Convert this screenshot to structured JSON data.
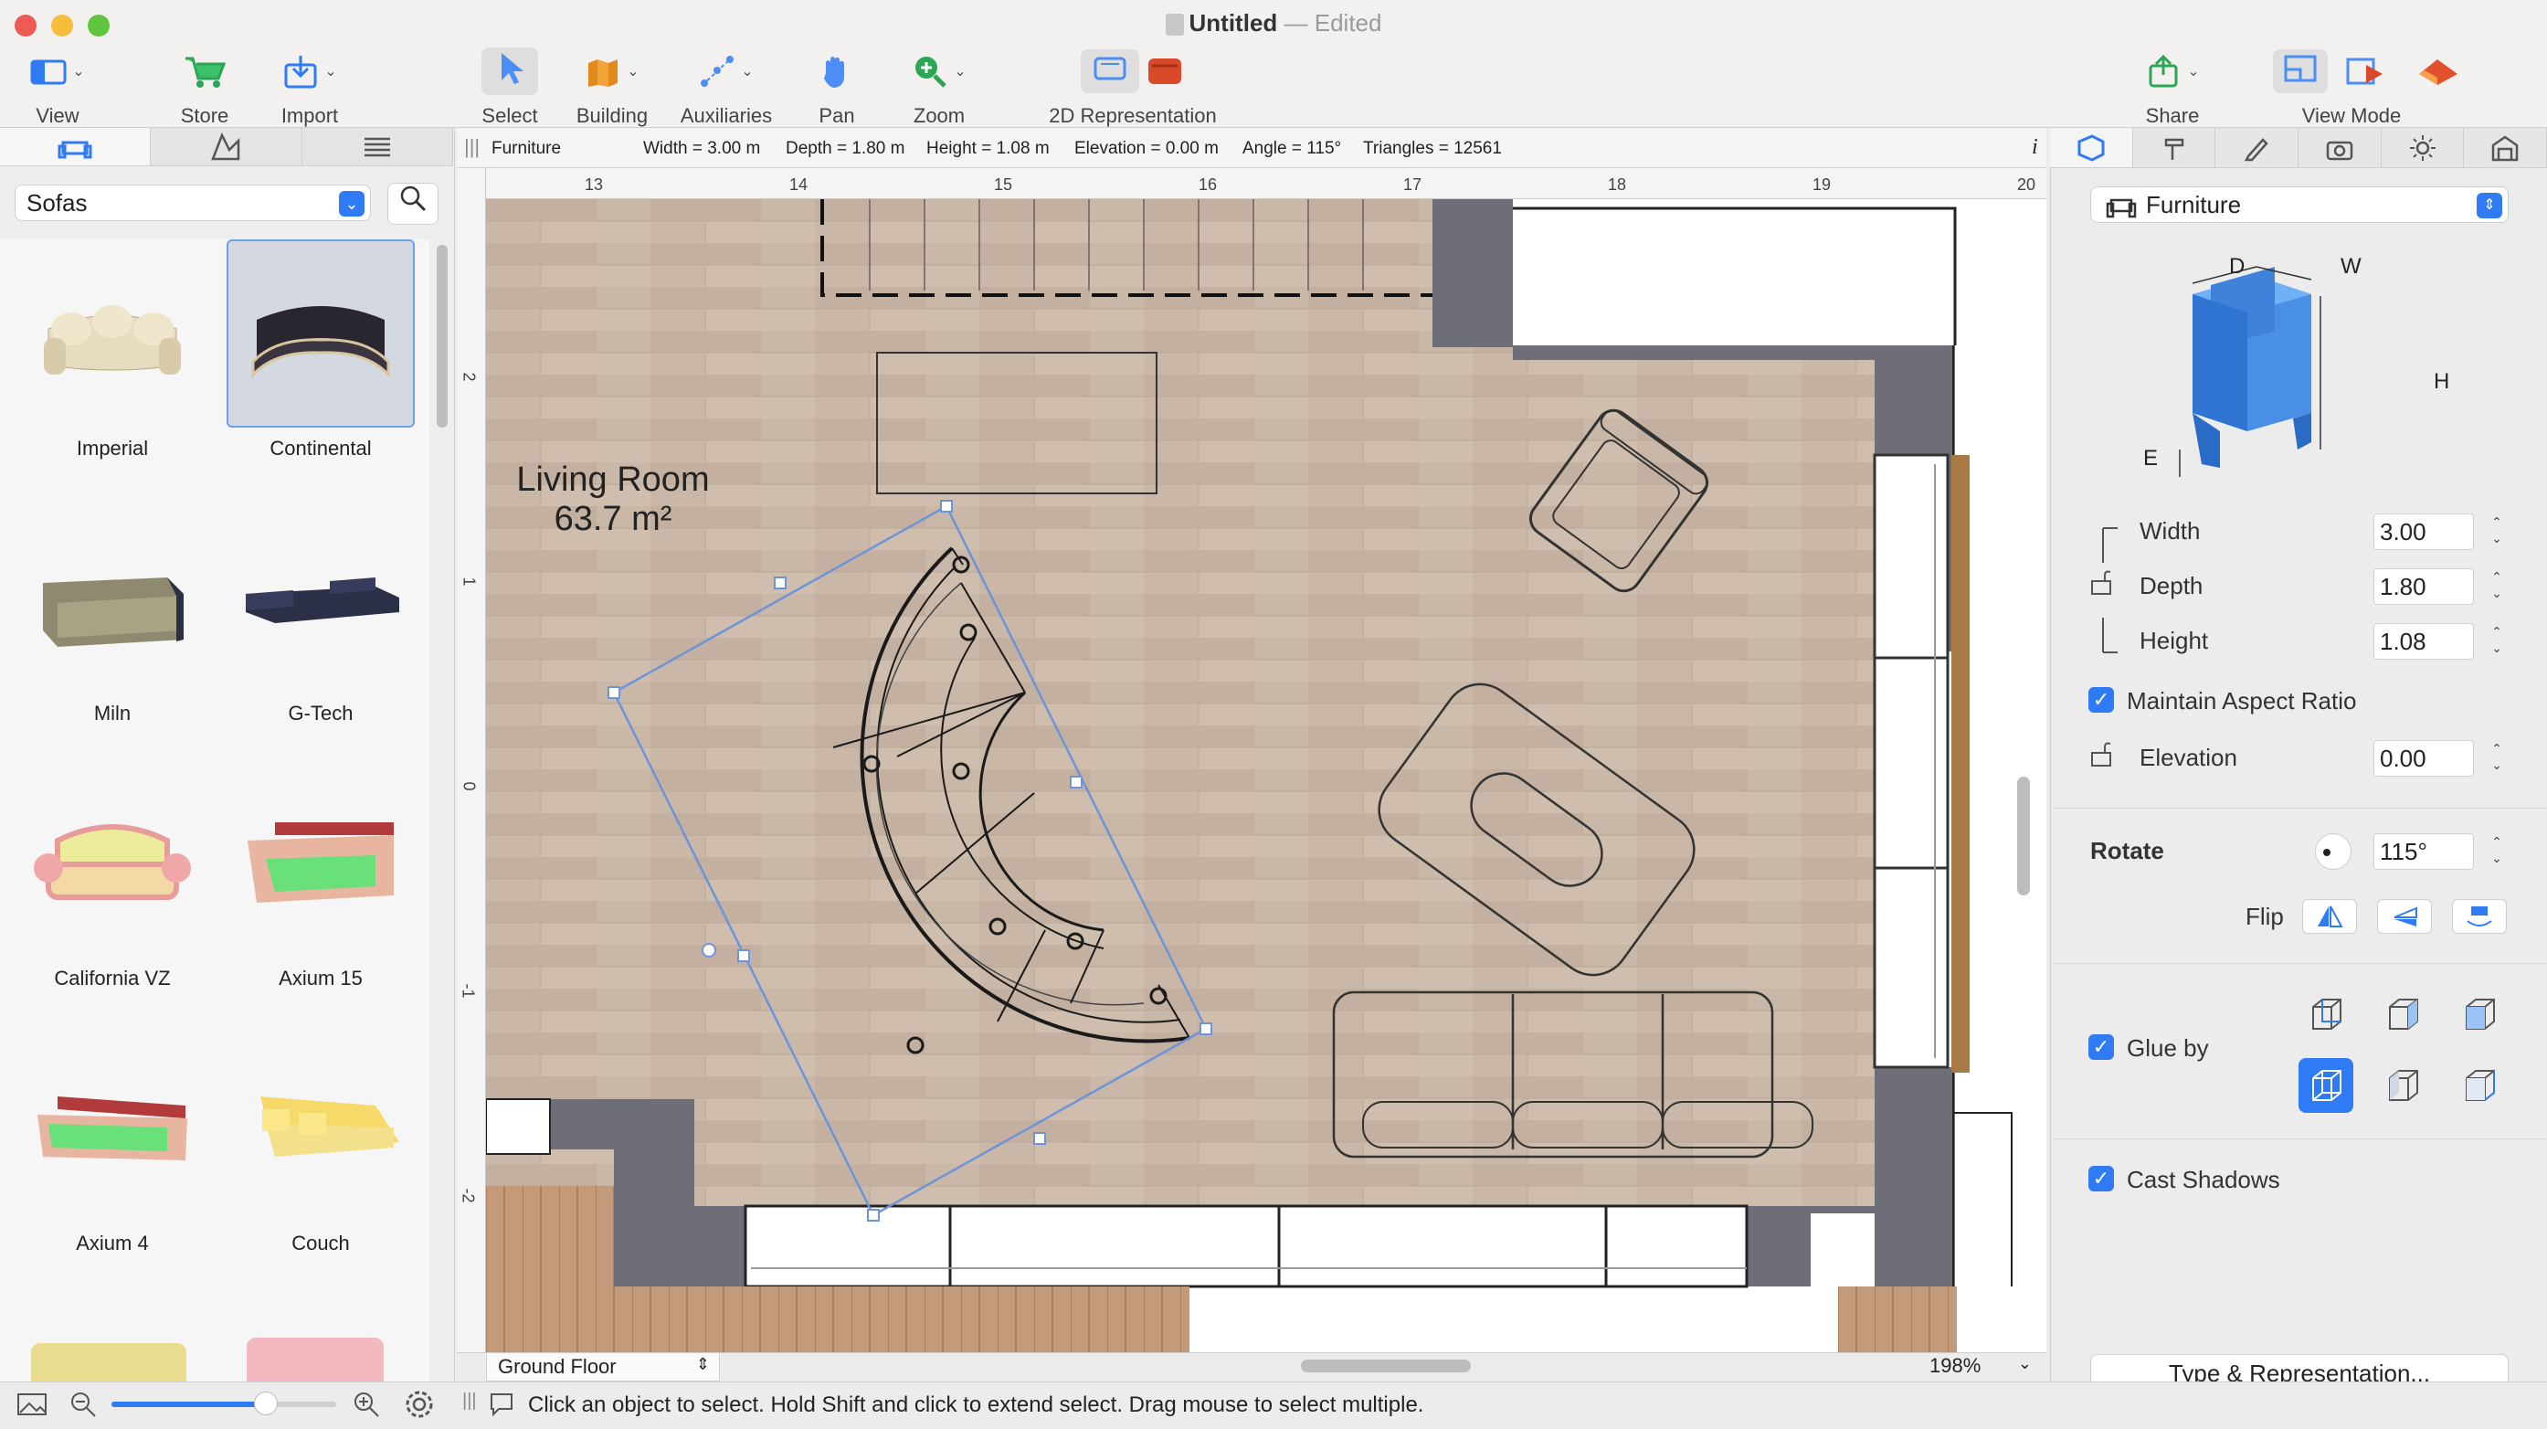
{
  "window": {
    "title": "Untitled",
    "edited": "— Edited"
  },
  "toolbar": {
    "view": "View",
    "store": "Store",
    "import": "Import",
    "select": "Select",
    "building": "Building",
    "auxiliaries": "Auxiliaries",
    "pan": "Pan",
    "zoom": "Zoom",
    "representation_2d": "2D Representation",
    "share": "Share",
    "view_mode": "View Mode"
  },
  "library": {
    "category": "Sofas",
    "items": [
      {
        "name": "Imperial"
      },
      {
        "name": "Continental"
      },
      {
        "name": "Miln"
      },
      {
        "name": "G-Tech"
      },
      {
        "name": "California VZ"
      },
      {
        "name": "Axium 15"
      },
      {
        "name": "Axium 4"
      },
      {
        "name": "Couch"
      }
    ],
    "selected": "Continental"
  },
  "infobar": {
    "object": "Furniture",
    "width": "Width = 3.00 m",
    "depth": "Depth = 1.80 m",
    "height": "Height = 1.08 m",
    "elevation": "Elevation = 0.00 m",
    "angle": "Angle = 115°",
    "triangles": "Triangles = 12561"
  },
  "ruler": {
    "unit": "m",
    "h_ticks": [
      "13",
      "14",
      "15",
      "16",
      "17",
      "18",
      "19",
      "20"
    ],
    "v_ticks": [
      "2",
      "1",
      "0",
      "-1",
      "-2"
    ]
  },
  "plan": {
    "room_name": "Living Room",
    "room_area": "63.7 m²"
  },
  "floor": "Ground Floor",
  "zoom_level": "198%",
  "status": "Click an object to select. Hold Shift and click to extend select. Drag mouse to select multiple.",
  "inspector": {
    "type": "Furniture",
    "diagram": {
      "d": "D",
      "w": "W",
      "h": "H",
      "e": "E"
    },
    "width_label": "Width",
    "width_value": "3.00",
    "depth_label": "Depth",
    "depth_value": "1.80",
    "height_label": "Height",
    "height_value": "1.08",
    "maintain_aspect": "Maintain Aspect Ratio",
    "elevation_label": "Elevation",
    "elevation_value": "0.00",
    "rotate_label": "Rotate",
    "rotate_value": "115°",
    "flip_label": "Flip",
    "glue_label": "Glue by",
    "cast_shadows": "Cast Shadows",
    "type_rep_button": "Type & Representation..."
  },
  "colors": {
    "accent": "#2f7bf5",
    "selection": "#6f93d8",
    "floor": "#c9b6a6",
    "wall": "#6e6e78"
  }
}
